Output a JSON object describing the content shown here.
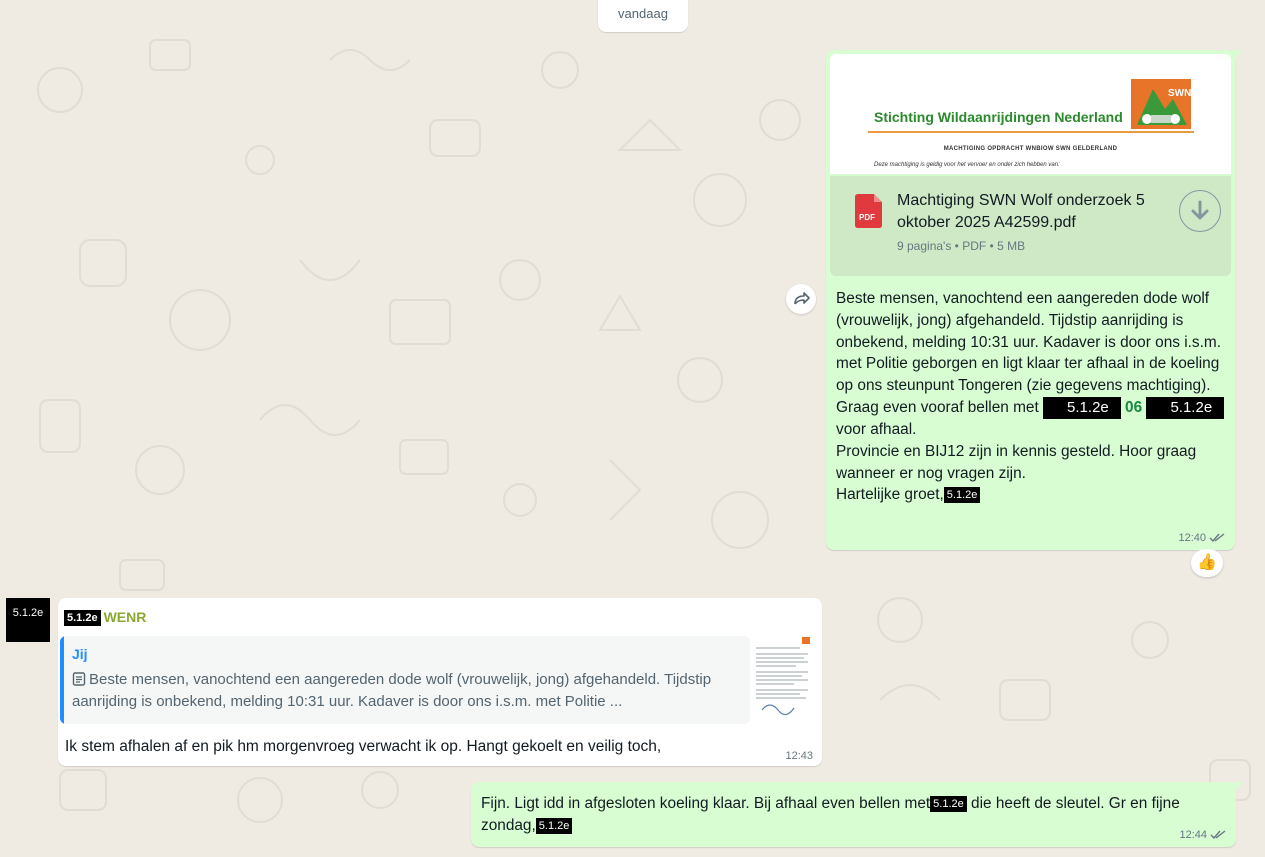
{
  "day_separator": "vandaag",
  "message_1": {
    "doc_preview": {
      "org_name": "Stichting Wildaanrijdingen Nederland",
      "logo_text": "SWN",
      "subtitle": "MACHTIGING OPDRACHT WNBIOW SWN GELDERLAND",
      "subtitle2": "Deze machtiging is geldig voor het vervoer en onder zich hebben van:"
    },
    "file": {
      "icon_label": "PDF",
      "name": "Machtiging SWN Wolf onderzoek 5 oktober 2025 A42599.pdf",
      "meta": "9 pagina's • PDF • 5 MB"
    },
    "text_p1": "Beste mensen, vanochtend een aangereden dode wolf (vrouwelijk, jong) afgehandeld. Tijdstip aanrijding is onbekend, melding 10:31 uur. Kadaver is door ons i.s.m. met Politie geborgen en ligt klaar ter afhaal in de koeling op ons steunpunt Tongeren (zie gegevens machtiging). Graag even vooraf bellen met ",
    "redact_a": "5.1.2e",
    "phone_mid": "06",
    "redact_b": "5.1.2e",
    "text_p2": "voor afhaal.",
    "text_p3": "Provincie en BIJ12 zijn in kennis gesteld. Hoor graag wanneer er nog vragen zijn.",
    "text_p4": "Hartelijke groet,",
    "redact_c": "5.1.2e",
    "time": "12:40",
    "reaction": "👍"
  },
  "message_2": {
    "avatar_redact": "5.1.2e",
    "sender_redact": "5.1.2e",
    "sender_org": "WENR",
    "quote_author": "Jij",
    "quote_text": "Beste mensen, vanochtend een aangereden dode wolf (vrouwelijk, jong) afgehandeld. Tijdstip aanrijding is onbekend, melding 10:31 uur. Kadaver is door ons i.s.m. met Politie ...",
    "text": "Ik stem afhalen af en pik hm  morgenvroeg verwacht ik op. Hangt gekoelt en veilig toch,",
    "time": "12:43"
  },
  "message_3": {
    "text_a": "Fijn. Ligt idd in afgesloten koeling klaar. Bij afhaal even bellen met",
    "redact_a": "5.1.2e",
    "text_b": " die heeft de sleutel. Gr en fijne zondag,",
    "redact_b": "5.1.2e",
    "time": "12:44"
  },
  "colors": {
    "chat_bg": "#efeae2",
    "outgoing_bubble": "#d9fdd3",
    "incoming_bubble": "#ffffff",
    "quote_accent": "#1f8dff",
    "read_tick": "#53bdeb"
  }
}
